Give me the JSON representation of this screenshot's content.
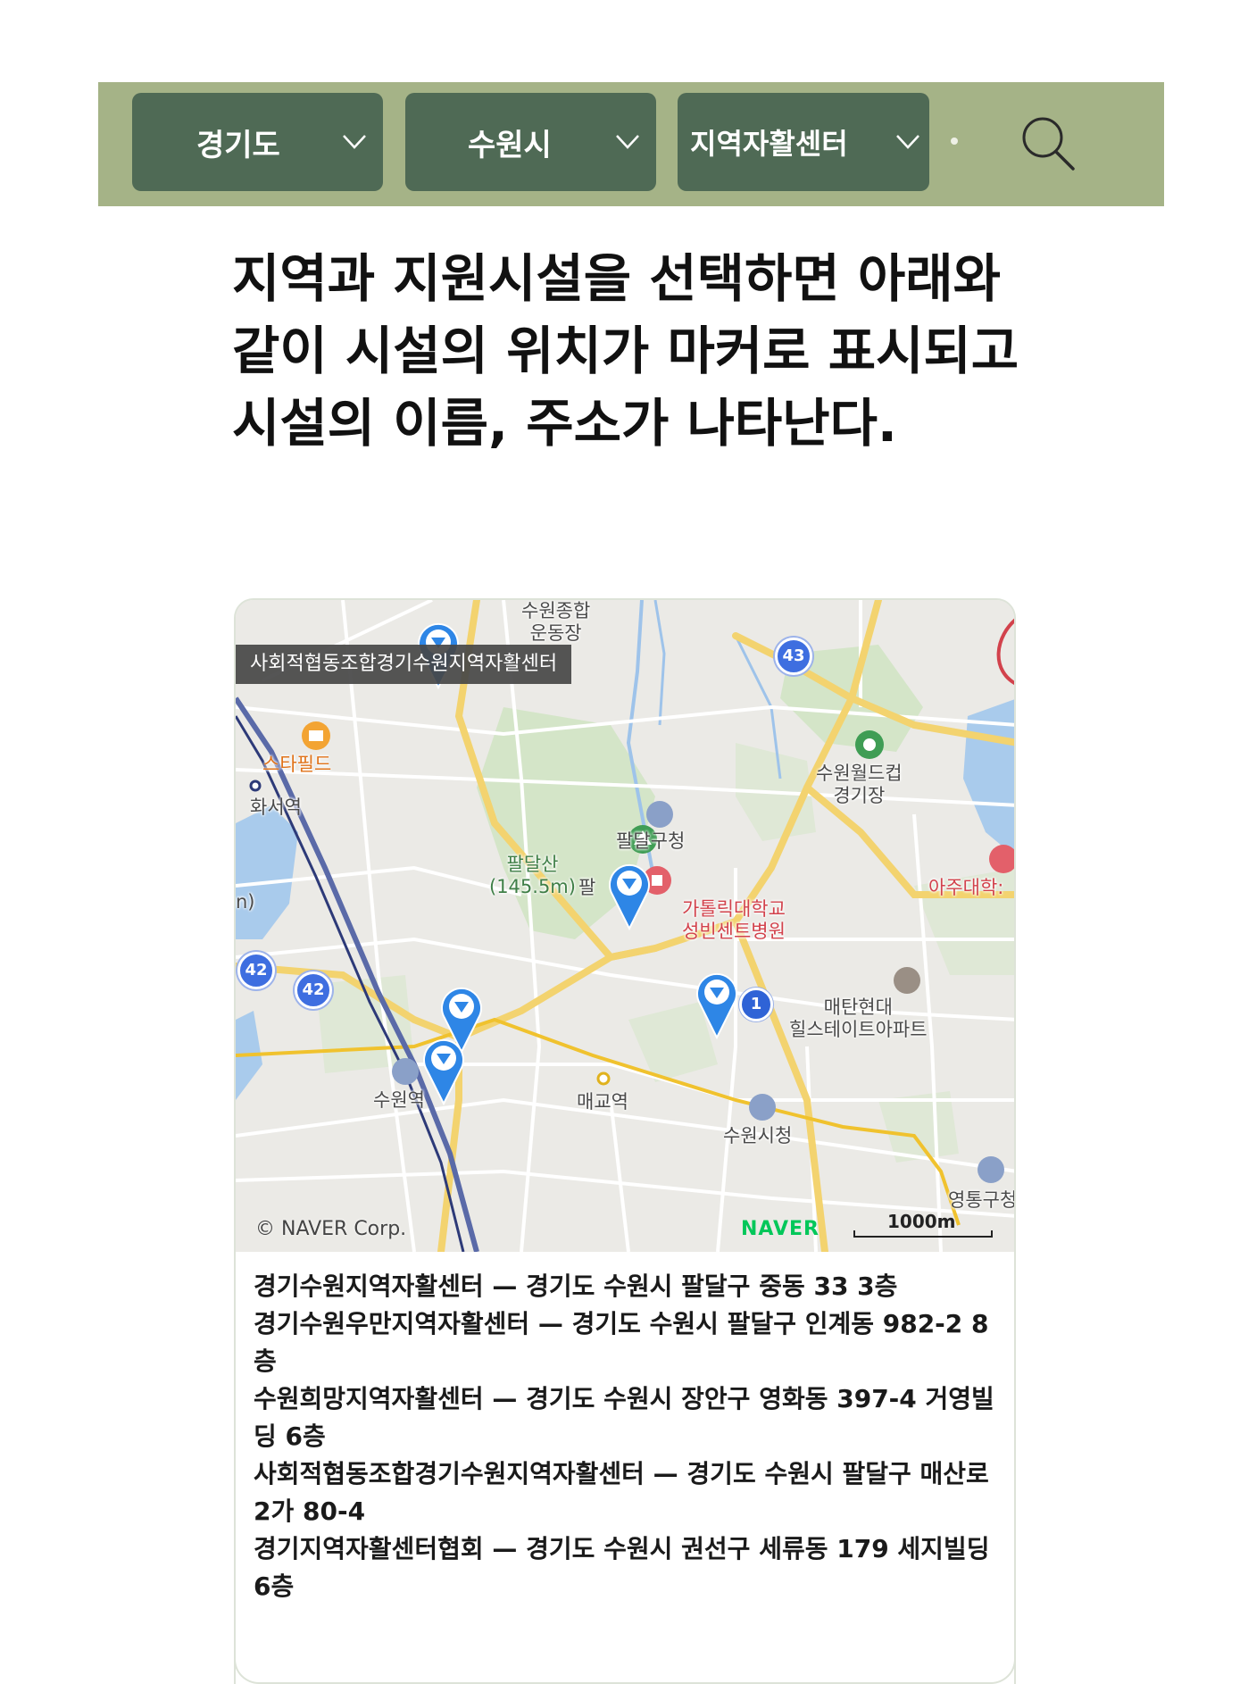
{
  "filters": {
    "region": "경기도",
    "city": "수원시",
    "facility_type": "지역자활센터"
  },
  "icons": {
    "select_arrow": "chevron-down-icon",
    "search": "search-icon",
    "marker": "map-pin-icon"
  },
  "heading": "지역과 지원시설을 선택하면 아래와 같이 시설의 위치가 마커로 표시되고 시설의 이름, 주소가 나타난다.",
  "map": {
    "tooltip": "사회적협동조합경기수원지역자활센터",
    "pois": {
      "stadium": "수원종합\n운동장",
      "starfield": "스타필드",
      "hwaseo": "화서역",
      "worldcup": "수원월드컵\n경기장",
      "paldal_office": "팔달구청",
      "paldal_mountain": "팔달산\n(145.5m)",
      "paldal_partial": "팔",
      "hospital": "가톨릭대학교\n성빈센트병원",
      "ajou": "아주대학:",
      "maetan": "매탄현대\n힐스테이트아파트",
      "suwon_station": "수원역",
      "maegyo": "매교역",
      "city_hall": "수원시청",
      "yeongtong": "영통구청",
      "partial_left": "n)"
    },
    "road_badges": [
      "43",
      "42",
      "42"
    ],
    "cluster_badge": "1",
    "copyright": "© NAVER Corp.",
    "logo": "NAVER",
    "scale": "1000m"
  },
  "facilities": [
    {
      "name": "경기수원지역자활센터",
      "address": "경기도 수원시 팔달구 중동 33 3층"
    },
    {
      "name": "경기수원우만지역자활센터",
      "address": "경기도 수원시 팔달구 인계동 982-2 8층"
    },
    {
      "name": "수원희망지역자활센터",
      "address": "경기도 수원시 장안구 영화동 397-4 거영빌딩 6층"
    },
    {
      "name": "사회적협동조합경기수원지역자활센터",
      "address": "경기도 수원시 팔달구 매산로2가 80-4"
    },
    {
      "name": "경기지역자활센터협회",
      "address": "경기도 수원시 권선구 세류동 179 세지빌딩 6층"
    }
  ],
  "separator": "—",
  "colors": {
    "filter_bar": "#a5b387",
    "select_bg": "#4f6a55",
    "marker": "#2e86e6",
    "naver_green": "#03c75a"
  }
}
